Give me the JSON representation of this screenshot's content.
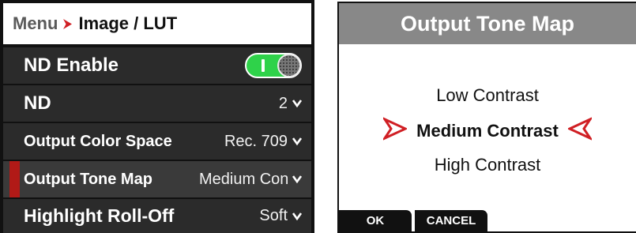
{
  "left": {
    "breadcrumb": {
      "menu": "Menu",
      "current": "Image / LUT"
    },
    "rows": [
      {
        "label": "ND Enable",
        "toggle_on": true
      },
      {
        "label": "ND",
        "value": "2"
      },
      {
        "label": "Output Color Space",
        "value": "Rec. 709"
      },
      {
        "label": "Output Tone Map",
        "value": "Medium Contrast",
        "selected": true
      },
      {
        "label": "Highlight Roll-Off",
        "value": "Soft"
      }
    ]
  },
  "right": {
    "title": "Output Tone Map",
    "options": [
      "Low Contrast",
      "Medium Contrast",
      "High Contrast"
    ],
    "selected_option": "Medium Contrast",
    "softkeys": {
      "ok": "OK",
      "cancel": "CANCEL"
    }
  },
  "colors": {
    "accent_red": "#d01f24",
    "toggle_green": "#2fd24a",
    "row_bg": "#2b2b2b",
    "header_gray": "#888888"
  }
}
